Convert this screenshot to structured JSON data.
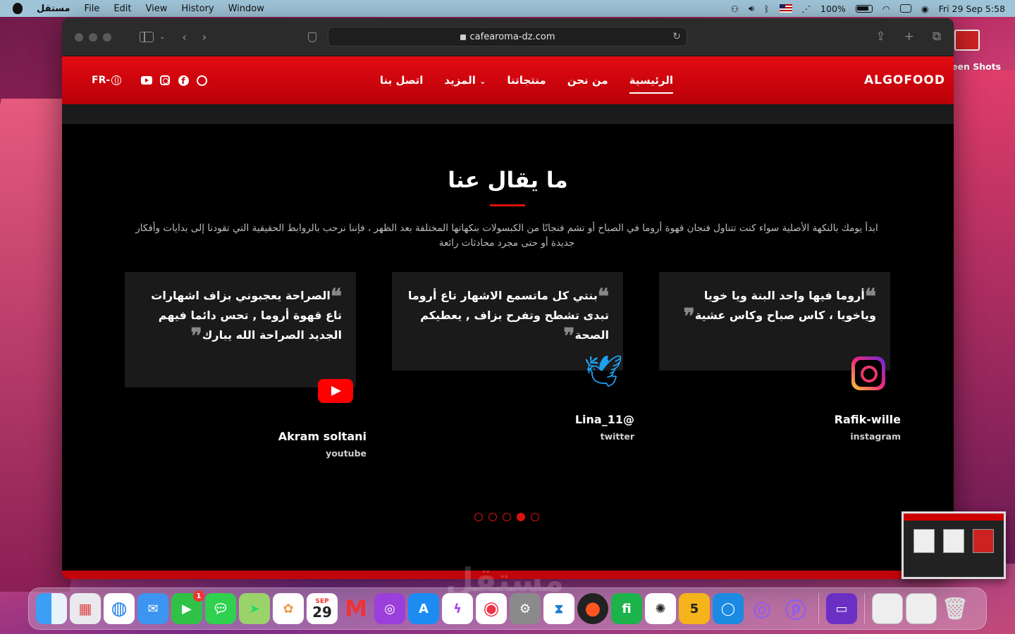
{
  "menubar": {
    "app_name": "مستقل",
    "items": [
      "File",
      "Edit",
      "View",
      "History",
      "Window"
    ],
    "battery": "100%",
    "datetime": "Fri 29 Sep  5:58"
  },
  "browser": {
    "url": "cafearoma-dz.com"
  },
  "site": {
    "brand": "ALGOFOOD",
    "nav": [
      {
        "label": "الرئيسية",
        "active": true
      },
      {
        "label": "من نحن",
        "active": false
      },
      {
        "label": "منتجاتنا",
        "active": false
      },
      {
        "label": "المزيد",
        "active": false
      },
      {
        "label": "اتصل بنا",
        "active": false
      }
    ],
    "lang": "FR-",
    "section": {
      "title": "ما يقال عنا",
      "intro": "ابدأ يومك بالنكهة الأصلية سواء كنت تتناول فنجان قهوة أروما في الصباح أو تشم فنجانًا من الكبسولات بنكهاتها المختلفة بعد الظهر ، فإننا نرحب بالروابط الحقيقية التي تقودنا إلى بدايات وأفكار جديدة أو حتى مجرد محادثات رائعة"
    },
    "testimonials": [
      {
        "text": "أروما فيها واحد البنة ويا خويا وياخويا ، كاس صباح وكاس عشية",
        "author": "Rafik-wille",
        "platform": "instagram"
      },
      {
        "text": "بنتي كل ماتسمع الاشهار تاع أروما تبدى تشطح وتفرح بزاف , يعطيكم الصحة",
        "author": "Lina_11@",
        "platform": "twitter"
      },
      {
        "text": "الصراحة يعجبوني بزاف اشهارات تاع قهوة أروما , تحس دائما فيهم الجديد الصراحة الله يبارك",
        "author": "Akram soltani",
        "platform": "youtube"
      }
    ],
    "carousel": {
      "count": 5,
      "active": 4
    }
  },
  "desktop": {
    "screenshot_label": "een Shots",
    "calendar_month": "SEP",
    "calendar_day": "29",
    "facetime_badge": "1",
    "watermark": "مستقل"
  },
  "colors": {
    "brand_red": "#e30b12",
    "accent_red": "#d9120f"
  }
}
